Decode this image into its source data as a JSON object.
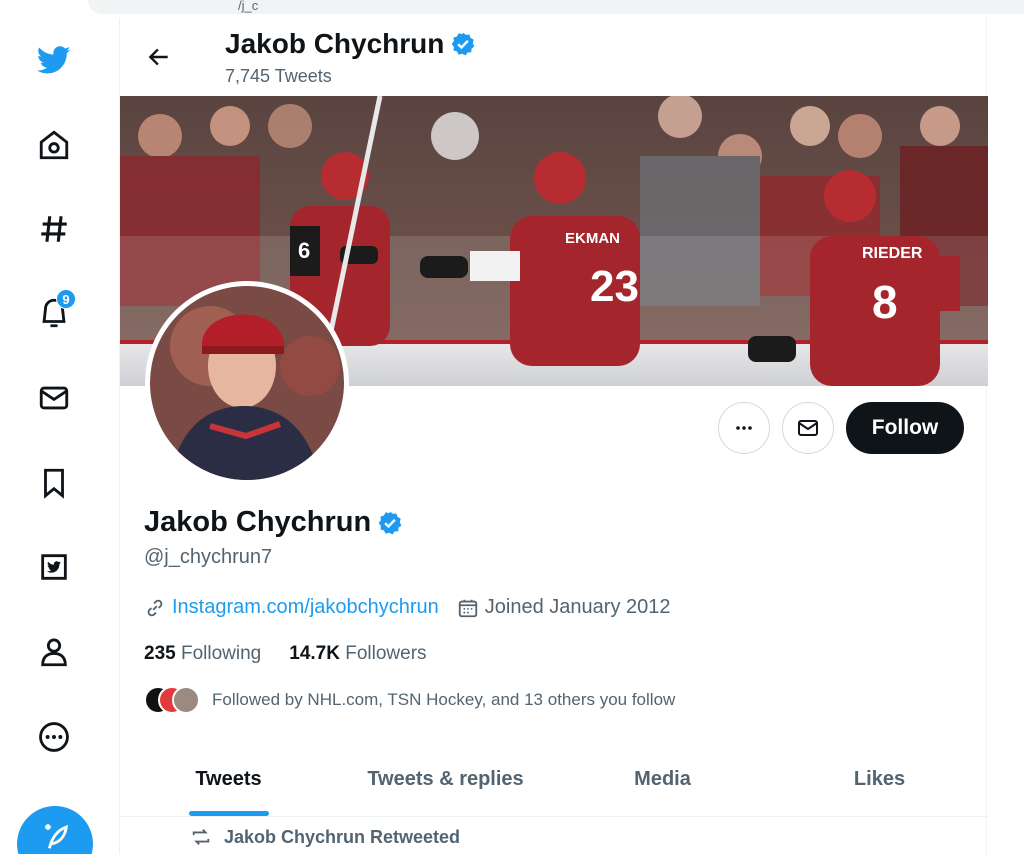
{
  "browser": {
    "url_text": "/j_c"
  },
  "nav": {
    "notifications_badge": "9"
  },
  "header": {
    "name": "Jakob Chychrun",
    "tweet_count": "7,745 Tweets"
  },
  "profile": {
    "name": "Jakob Chychrun",
    "handle": "@j_chychrun7",
    "website": "Instagram.com/jakobchychrun",
    "joined": "Joined January 2012",
    "following_count": "235",
    "following_label": "Following",
    "followers_count": "14.7K",
    "followers_label": "Followers",
    "followed_by": "Followed by NHL.com, TSN Hockey, and 13 others you follow"
  },
  "actions": {
    "follow_label": "Follow"
  },
  "tabs": [
    {
      "label": "Tweets",
      "active": true
    },
    {
      "label": "Tweets & replies",
      "active": false
    },
    {
      "label": "Media",
      "active": false
    },
    {
      "label": "Likes",
      "active": false
    }
  ],
  "timeline": {
    "retweet_label": "Jakob Chychrun Retweeted"
  },
  "banner": {
    "jersey_numbers": [
      "6",
      "23",
      "8"
    ],
    "jersey_names": [
      "EKMAN",
      "RIEDER"
    ]
  },
  "colors": {
    "accent": "#1d9bf0",
    "text": "#0f1419",
    "secondary": "#536471",
    "jersey_red": "#a4262c"
  },
  "icons": {
    "nav": [
      "twitter-logo-icon",
      "home-icon",
      "explore-hashtag-icon",
      "notifications-bell-icon",
      "messages-envelope-icon",
      "bookmark-icon",
      "twitter-blue-icon",
      "profile-person-icon",
      "more-circle-icon"
    ]
  }
}
